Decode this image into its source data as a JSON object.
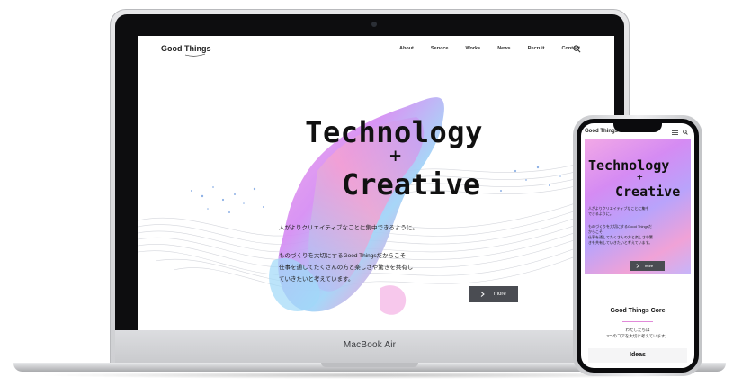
{
  "laptop": {
    "device_label": "MacBook Air",
    "site": {
      "logo": "Good Things",
      "nav": [
        "About",
        "Service",
        "Works",
        "News",
        "Recruit",
        "Contact"
      ],
      "hero": {
        "title_line1": "Technology",
        "plus": "+",
        "title_line2": "Creative",
        "tagline": "人がよりクリエイティブなことに集中できるように。",
        "body_line1": "ものづくりを大切にするGood Thingsだからこそ",
        "body_line2": "仕事を通してたくさんの方と楽しさや驚きを共有し",
        "body_line3": "ていきたいと考えています。",
        "more_label": "more"
      }
    }
  },
  "phone": {
    "logo": "Good Things",
    "hero": {
      "title_line1": "Technology",
      "plus": "+",
      "title_line2": "Creative",
      "tagline_1": "人がよりクリエイティブなことに集中",
      "tagline_2": "できるように。",
      "body_1": "ものづくりを大切にするGood Thingsだ",
      "body_2": "からこそ",
      "body_3": "仕事を通してたくさんの方と楽しさや驚",
      "body_4": "きを共有していきたいと考えています。",
      "more_label": "more"
    },
    "core": {
      "heading": "Good Things Core",
      "text_1": "わたしたちは",
      "text_2": "3つのコアを大切に考えています。"
    },
    "ideas_label": "Ideas"
  },
  "icons": {
    "search": "search-icon",
    "menu": "hamburger-menu-icon",
    "more_arrow": "chevron-right-icon"
  },
  "colors": {
    "gradient_pink": "#f2a8e6",
    "gradient_violet": "#d58bf3",
    "gradient_blue": "#b9a3fb",
    "button_gray": "#4a4c52",
    "accent_line": "#e18ad9"
  }
}
